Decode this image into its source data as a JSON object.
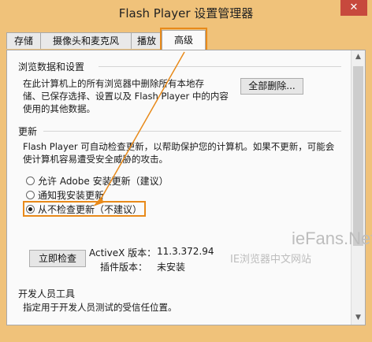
{
  "window": {
    "title": "Flash Player 设置管理器",
    "close_glyph": "✕"
  },
  "tabs": [
    {
      "label": "存储"
    },
    {
      "label": "摄像头和麦克风"
    },
    {
      "label": "播放"
    },
    {
      "label": "高级",
      "active": true
    }
  ],
  "browsing": {
    "title": "浏览数据和设置",
    "description_lines": [
      "在此计算机上的所有浏览器中删除所有本地存",
      "储、已保存选择、设置以及 Flash Player 中的内容",
      "使用的其他数据。"
    ],
    "delete_all_button": "全部删除..."
  },
  "updates": {
    "title": "更新",
    "description_lines": [
      "Flash Player 可自动检查更新，以帮助保护您的计算机。如果不更新，可能会",
      "使计算机容易遭受安全威胁的攻击。"
    ],
    "options": [
      {
        "label": "允许 Adobe 安装更新（建议）",
        "selected": false
      },
      {
        "label": "通知我安装更新",
        "selected": false
      },
      {
        "label": "从不检查更新（不建议）",
        "selected": true
      }
    ],
    "check_now_button": "立即检查",
    "activex_label": "ActiveX 版本：",
    "activex_value": "11.3.372.94",
    "plugin_label": "插件版本：",
    "plugin_value": "未安装"
  },
  "developer": {
    "title": "开发人员工具",
    "description": "指定用于开发人员测试的受信任位置。"
  },
  "watermark": {
    "brand": "ieFans.Net",
    "sub": "IE浏览器中文网站"
  },
  "colors": {
    "highlight": "#e88a1a",
    "frame": "#f0c27a",
    "close": "#c7493d"
  }
}
